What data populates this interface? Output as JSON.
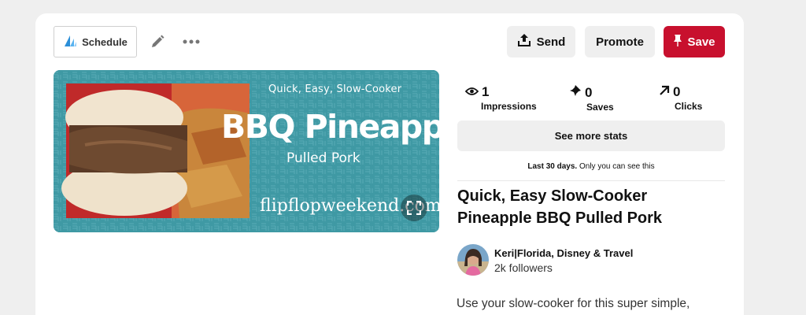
{
  "toolbar": {
    "schedule_label": "Schedule",
    "send_label": "Send",
    "promote_label": "Promote",
    "save_label": "Save"
  },
  "pin_image": {
    "subtitle": "Quick, Easy, Slow-Cooker",
    "title": "BBQ Pineapple",
    "tagline": "Pulled Pork",
    "site": "flipflopweekend.com"
  },
  "stats": {
    "impressions": {
      "value": "1",
      "label": "Impressions"
    },
    "saves": {
      "value": "0",
      "label": "Saves"
    },
    "clicks": {
      "value": "0",
      "label": "Clicks"
    },
    "see_more_label": "See more stats",
    "range_bold": "Last 30 days.",
    "range_note": " Only you can see this"
  },
  "pin": {
    "title": "Quick, Easy Slow-Cooker Pineapple BBQ Pulled Pork",
    "description": "Use your slow-cooker for this super simple,"
  },
  "user": {
    "name": "Keri|Florida, Disney & Travel",
    "followers": "2k followers"
  },
  "colors": {
    "save_red": "#c8102e",
    "image_teal": "#3f99a4"
  }
}
